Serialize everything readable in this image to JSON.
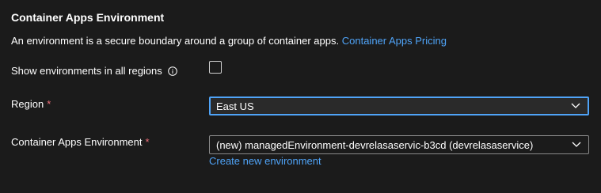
{
  "section": {
    "title": "Container Apps Environment",
    "description": "An environment is a secure boundary around a group of container apps.",
    "pricing_link": "Container Apps Pricing"
  },
  "show_all_regions": {
    "label": "Show environments in all regions",
    "checked": false,
    "icon": "info-icon"
  },
  "region": {
    "label": "Region",
    "required_mark": "*",
    "value": "East US"
  },
  "environment": {
    "label": "Container Apps Environment",
    "required_mark": "*",
    "value": "(new) managedEnvironment-devrelasaservic-b3cd (devrelasaservice)",
    "create_link": "Create new environment"
  },
  "colors": {
    "background": "#1b1b1b",
    "link": "#4fa3f7",
    "required": "#f1707b",
    "focus_border": "#4fa3f7"
  }
}
